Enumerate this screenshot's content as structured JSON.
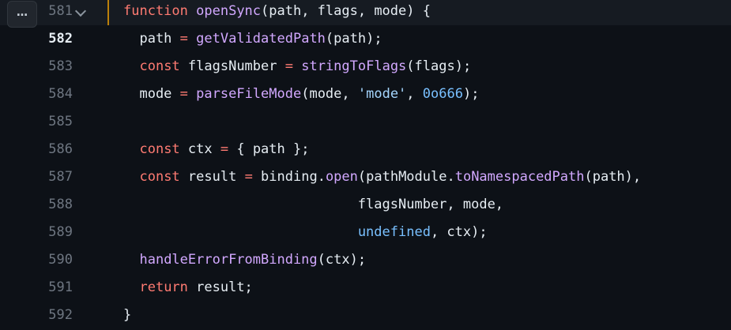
{
  "more_button": {
    "label": "…"
  },
  "lines": [
    {
      "number": "581",
      "tokens": [
        {
          "t": "function",
          "c": "kw"
        },
        {
          "t": " ",
          "c": "op"
        },
        {
          "t": "openSync",
          "c": "fn"
        },
        {
          "t": "(path, flags, mode) {",
          "c": "op"
        }
      ]
    },
    {
      "number": "582",
      "tokens": [
        {
          "t": "  path ",
          "c": "op"
        },
        {
          "t": "=",
          "c": "kw"
        },
        {
          "t": " ",
          "c": "op"
        },
        {
          "t": "getValidatedPath",
          "c": "fn"
        },
        {
          "t": "(path);",
          "c": "op"
        }
      ]
    },
    {
      "number": "583",
      "tokens": [
        {
          "t": "  ",
          "c": "op"
        },
        {
          "t": "const",
          "c": "kw"
        },
        {
          "t": " flagsNumber ",
          "c": "op"
        },
        {
          "t": "=",
          "c": "kw"
        },
        {
          "t": " ",
          "c": "op"
        },
        {
          "t": "stringToFlags",
          "c": "fn"
        },
        {
          "t": "(flags);",
          "c": "op"
        }
      ]
    },
    {
      "number": "584",
      "tokens": [
        {
          "t": "  mode ",
          "c": "op"
        },
        {
          "t": "=",
          "c": "kw"
        },
        {
          "t": " ",
          "c": "op"
        },
        {
          "t": "parseFileMode",
          "c": "fn"
        },
        {
          "t": "(mode, ",
          "c": "op"
        },
        {
          "t": "'mode'",
          "c": "str"
        },
        {
          "t": ", ",
          "c": "op"
        },
        {
          "t": "0o666",
          "c": "num"
        },
        {
          "t": ");",
          "c": "op"
        }
      ]
    },
    {
      "number": "585",
      "tokens": []
    },
    {
      "number": "586",
      "tokens": [
        {
          "t": "  ",
          "c": "op"
        },
        {
          "t": "const",
          "c": "kw"
        },
        {
          "t": " ctx ",
          "c": "op"
        },
        {
          "t": "=",
          "c": "kw"
        },
        {
          "t": " { path };",
          "c": "op"
        }
      ]
    },
    {
      "number": "587",
      "tokens": [
        {
          "t": "  ",
          "c": "op"
        },
        {
          "t": "const",
          "c": "kw"
        },
        {
          "t": " result ",
          "c": "op"
        },
        {
          "t": "=",
          "c": "kw"
        },
        {
          "t": " binding.",
          "c": "op"
        },
        {
          "t": "open",
          "c": "fn"
        },
        {
          "t": "(pathModule.",
          "c": "op"
        },
        {
          "t": "toNamespacedPath",
          "c": "fn"
        },
        {
          "t": "(path),",
          "c": "op"
        }
      ]
    },
    {
      "number": "588",
      "tokens": [
        {
          "t": "                             flagsNumber, mode,",
          "c": "op"
        }
      ]
    },
    {
      "number": "589",
      "tokens": [
        {
          "t": "                             ",
          "c": "op"
        },
        {
          "t": "undefined",
          "c": "num"
        },
        {
          "t": ", ctx);",
          "c": "op"
        }
      ]
    },
    {
      "number": "590",
      "tokens": [
        {
          "t": "  ",
          "c": "op"
        },
        {
          "t": "handleErrorFromBinding",
          "c": "fn"
        },
        {
          "t": "(ctx);",
          "c": "op"
        }
      ]
    },
    {
      "number": "591",
      "tokens": [
        {
          "t": "  ",
          "c": "op"
        },
        {
          "t": "return",
          "c": "kw"
        },
        {
          "t": " result;",
          "c": "op"
        }
      ]
    },
    {
      "number": "592",
      "tokens": [
        {
          "t": "}",
          "c": "op"
        }
      ]
    }
  ],
  "active_line": "581",
  "current_line": "582",
  "colors": {
    "background": "#0d1117",
    "keyword": "#ff7b72",
    "function": "#d2a8ff",
    "string": "#a5d6ff",
    "constant": "#79c0ff",
    "highlight_bar": "#bb800a"
  }
}
